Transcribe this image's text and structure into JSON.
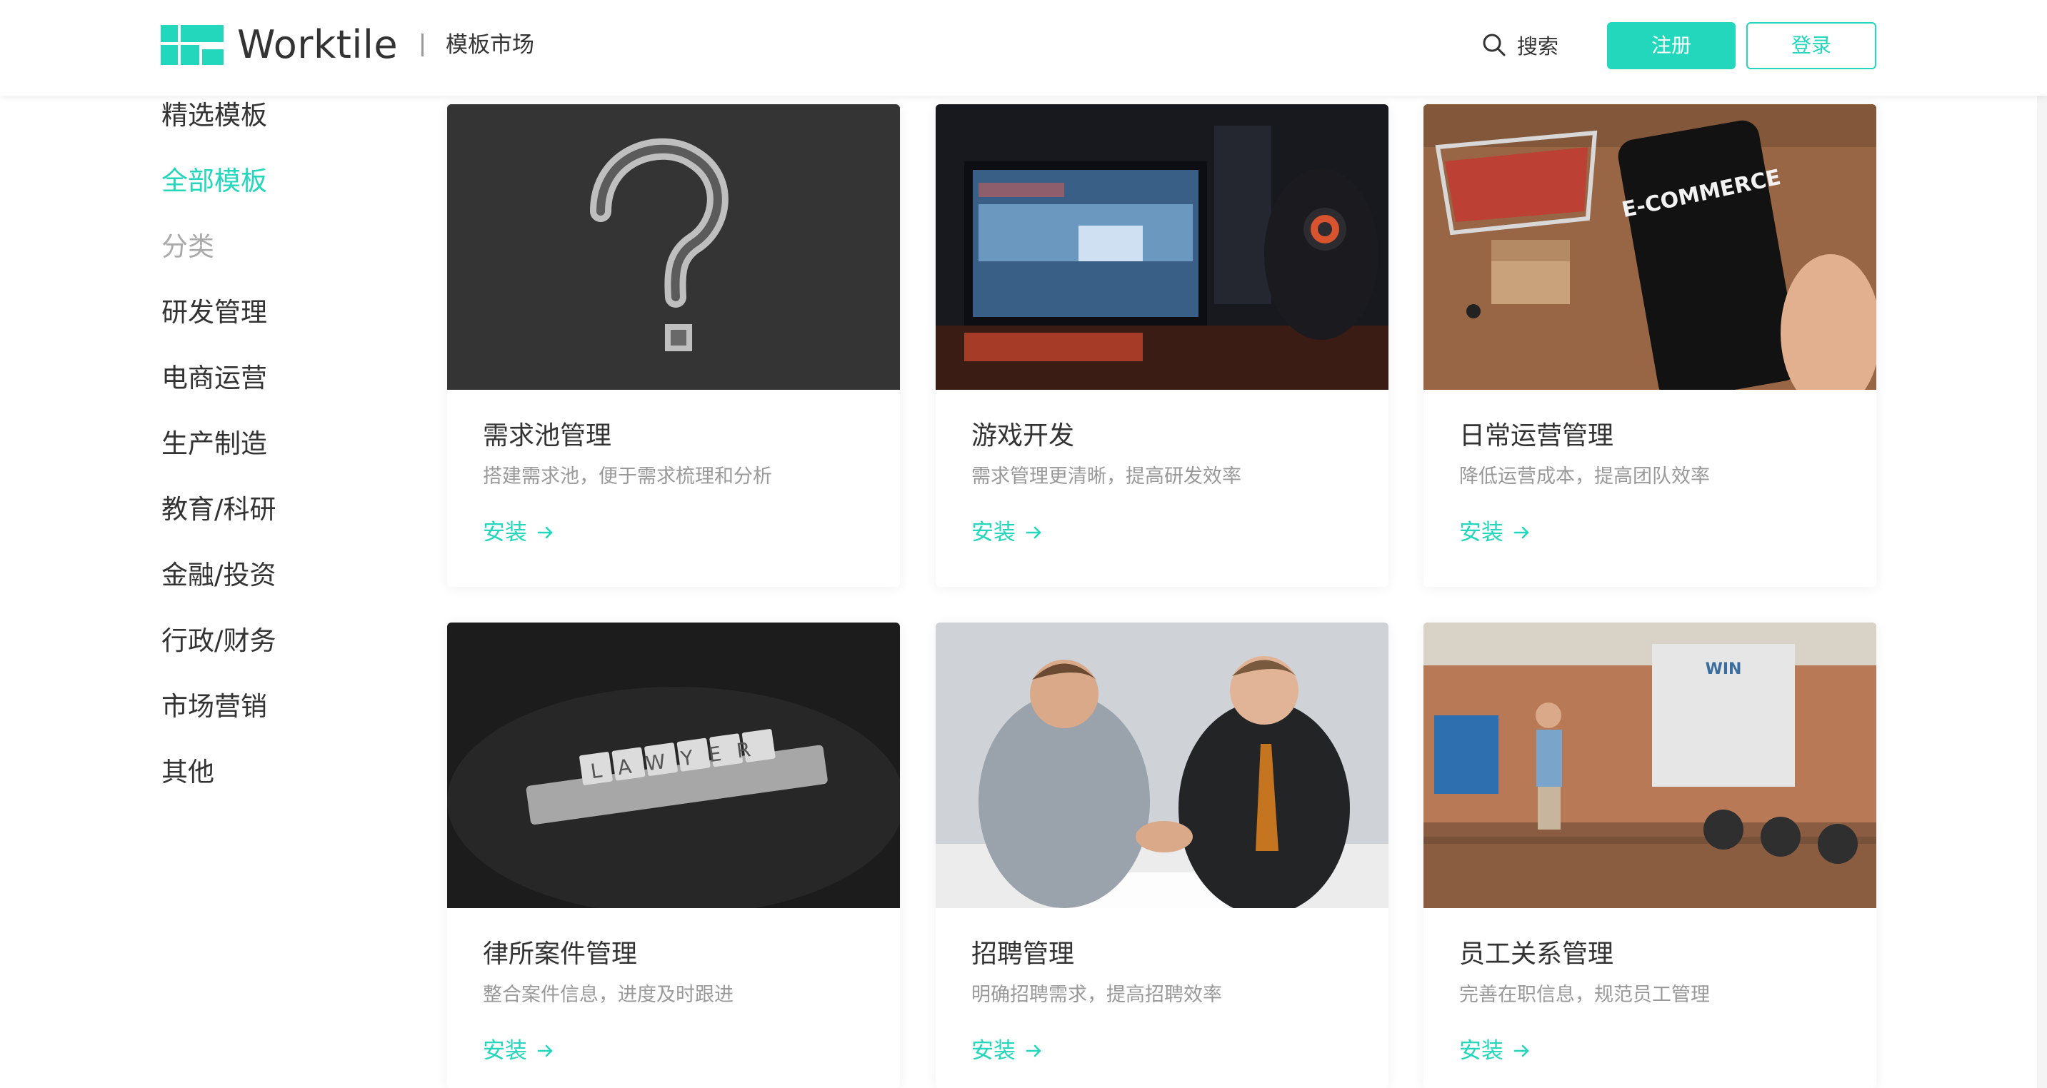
{
  "brand": {
    "name": "Worktile",
    "section": "模板市场",
    "accent_color": "#22d7bb"
  },
  "header": {
    "search_label": "搜索",
    "register_label": "注册",
    "login_label": "登录"
  },
  "sidebar": {
    "items": [
      {
        "label": "精选模板",
        "state": "normal"
      },
      {
        "label": "全部模板",
        "state": "active"
      },
      {
        "label": "分类",
        "state": "group-heading"
      },
      {
        "label": "研发管理",
        "state": "normal"
      },
      {
        "label": "电商运营",
        "state": "normal"
      },
      {
        "label": "生产制造",
        "state": "normal"
      },
      {
        "label": "教育/科研",
        "state": "normal"
      },
      {
        "label": "金融/投资",
        "state": "normal"
      },
      {
        "label": "行政/财务",
        "state": "normal"
      },
      {
        "label": "市场营销",
        "state": "normal"
      },
      {
        "label": "其他",
        "state": "normal"
      }
    ]
  },
  "cards": [
    {
      "title": "需求池管理",
      "description": "搭建需求池，便于需求梳理和分析",
      "action": "安装",
      "image": "chalkboard-question-mark"
    },
    {
      "title": "游戏开发",
      "description": "需求管理更清晰，提高研发效率",
      "action": "安装",
      "image": "gamer-at-monitor"
    },
    {
      "title": "日常运营管理",
      "description": "降低运营成本，提高团队效率",
      "action": "安装",
      "image": "ecommerce-phone-cart",
      "image_text": "E-COMMERCE"
    },
    {
      "title": "律所案件管理",
      "description": "整合案件信息，进度及时跟进",
      "action": "安装",
      "image": "lawyer-tiles",
      "image_text": "LAWYER"
    },
    {
      "title": "招聘管理",
      "description": "明确招聘需求，提高招聘效率",
      "action": "安装",
      "image": "handshake-interview"
    },
    {
      "title": "员工关系管理",
      "description": "完善在职信息，规范员工管理",
      "action": "安装",
      "image": "office-presentation",
      "image_text": "WIN"
    }
  ]
}
